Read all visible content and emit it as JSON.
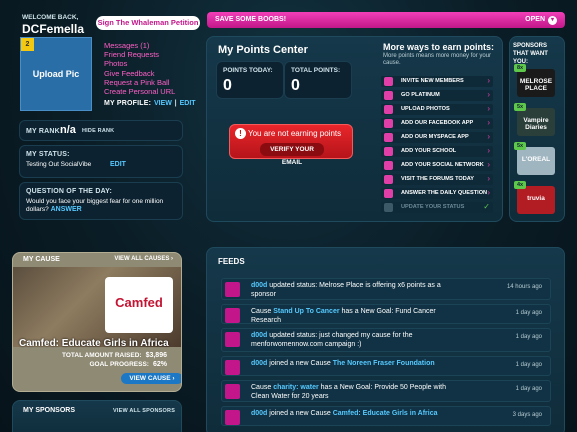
{
  "header": {
    "welcome": "WELCOME BACK,",
    "username": "DCFemella",
    "petition": "Sign The Whaleman Petition",
    "banner": "SAVE SOME BOOBS!",
    "banner_open": "OPEN"
  },
  "profile": {
    "upload": "Upload Pic",
    "badge": "2",
    "links": [
      "Messages (1)",
      "Friend Requests",
      "Photos",
      "Give Feedback",
      "Request a Pink Ball",
      "Create Personal URL"
    ],
    "my_profile": "MY PROFILE:",
    "view": "VIEW",
    "edit": "EDIT",
    "rank_label": "MY RANK:",
    "rank_value": "n/a",
    "hide_rank": "HIDE RANK",
    "status_label": "MY STATUS:",
    "status_value": "Testing Out SocialVibe",
    "status_edit": "EDIT",
    "qotd_label": "QUESTION OF THE DAY:",
    "qotd_text": "Would you face your biggest fear for one million dollars?",
    "qotd_answer": "ANSWER"
  },
  "points": {
    "title": "My Points Center",
    "today_label": "POINTS TODAY:",
    "today_value": "0",
    "total_label": "TOTAL POINTS:",
    "total_value": "0",
    "warning": "You are not earning points",
    "verify": "VERIFY YOUR EMAIL"
  },
  "ways": {
    "title": "More ways to earn points:",
    "subtitle": "More points means more money for your cause.",
    "items": [
      "INVITE NEW MEMBERS",
      "GO PLATINUM",
      "UPLOAD PHOTOS",
      "ADD OUR FACEBOOK APP",
      "ADD OUR MYSPACE APP",
      "ADD YOUR SCHOOL",
      "ADD YOUR SOCIAL NETWORK",
      "VISIT THE FORUMS TODAY",
      "ANSWER THE DAILY QUESTION",
      "UPDATE YOUR STATUS"
    ]
  },
  "sponsors": {
    "title": "SPONSORS THAT WANT YOU:",
    "items": [
      {
        "badge": "8x",
        "name": "MELROSE PLACE",
        "color": "#1a1a1a"
      },
      {
        "badge": "5x",
        "name": "Vampire Diaries",
        "color": "#2b3f3a"
      },
      {
        "badge": "5x",
        "name": "L'OREAL",
        "color": "#9fb5c0"
      },
      {
        "badge": "4x",
        "name": "truvia",
        "color": "#b21d24"
      }
    ]
  },
  "cause": {
    "header": "MY CAUSE",
    "view_all": "VIEW ALL CAUSES",
    "logo": "Camfed",
    "name": "Camfed: Educate Girls in Africa",
    "raised_label": "TOTAL AMOUNT RAISED:",
    "raised_value": "$3,896",
    "progress_label": "GOAL PROGRESS:",
    "progress_value": "62%",
    "view_cause": "VIEW CAUSE"
  },
  "my_sponsors": {
    "header": "MY SPONSORS",
    "view_all": "VIEW ALL SPONSORS"
  },
  "feeds": {
    "title": "FEEDS",
    "items": [
      {
        "user": "d00d",
        "text": " updated status: Melrose Place is offering x6 points as a sponsor",
        "time": "14 hours ago"
      },
      {
        "user": "",
        "pre": "Cause ",
        "link": "Stand Up To Cancer",
        "text": " has a New Goal: Fund Cancer Research",
        "time": "1 day ago"
      },
      {
        "user": "d00d",
        "text": " updated status: just changed my cause for the menforwomennow.com campaign :)",
        "time": "1 day ago"
      },
      {
        "user": "d00d",
        "text": " joined a new Cause ",
        "link2": "The Noreen Fraser Foundation",
        "time": "1 day ago"
      },
      {
        "user": "",
        "pre": "Cause ",
        "link": "charity: water",
        "text": " has a New Goal: Provide 50 People with Clean Water for 20 years",
        "time": "1 day ago"
      },
      {
        "user": "d00d",
        "text": " joined a new Cause ",
        "link2": "Camfed: Educate Girls in Africa",
        "time": "3 days ago"
      }
    ]
  }
}
